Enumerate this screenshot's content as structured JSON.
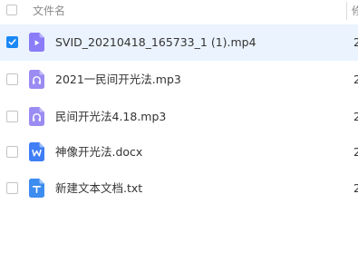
{
  "header": {
    "name_label": "文件名",
    "next_col_label": "修"
  },
  "colors": {
    "selected_row_bg": "#eaf3fe",
    "checkbox_checked": "#1a88f5",
    "video_icon": "#8b7cf7",
    "audio_icon": "#9a8cf2",
    "docx_icon": "#3f7ef6",
    "txt_icon": "#3d8cf0"
  },
  "files": [
    {
      "name": "SVID_20210418_165733_1 (1).mp4",
      "type": "video",
      "icon": "video-file-icon",
      "selected": true,
      "next_col": "2"
    },
    {
      "name": "2021一民间开光法.mp3",
      "type": "audio",
      "icon": "audio-file-icon",
      "selected": false,
      "next_col": "2"
    },
    {
      "name": "民间开光法4.18.mp3",
      "type": "audio",
      "icon": "audio-file-icon",
      "selected": false,
      "next_col": "2"
    },
    {
      "name": "神像开光法.docx",
      "type": "docx",
      "icon": "word-file-icon",
      "selected": false,
      "next_col": "2"
    },
    {
      "name": "新建文本文档.txt",
      "type": "txt",
      "icon": "text-file-icon",
      "selected": false,
      "next_col": "2"
    }
  ]
}
